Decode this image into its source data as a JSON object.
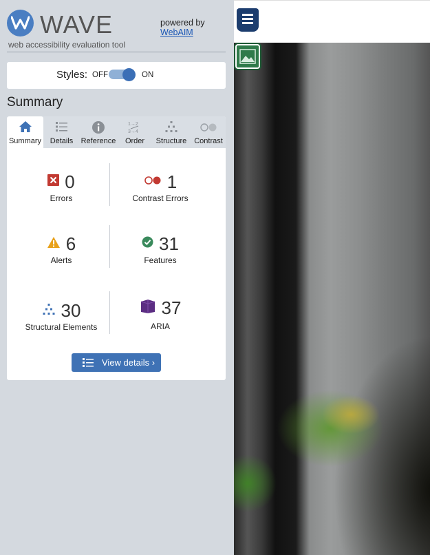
{
  "app": {
    "logo_text": "WAVE",
    "tagline": "web accessibility evaluation tool",
    "powered_by": "powered by",
    "powered_link": "WebAIM"
  },
  "styles": {
    "label": "Styles:",
    "off": "OFF",
    "on": "ON",
    "enabled": true
  },
  "section_title": "Summary",
  "tabs": [
    {
      "label": "Summary",
      "icon": "home-icon",
      "active": true
    },
    {
      "label": "Details",
      "icon": "list-icon",
      "active": false
    },
    {
      "label": "Reference",
      "icon": "info-icon",
      "active": false
    },
    {
      "label": "Order",
      "icon": "order-icon",
      "active": false
    },
    {
      "label": "Structure",
      "icon": "structure-icon",
      "active": false
    },
    {
      "label": "Contrast",
      "icon": "contrast-icon",
      "active": false
    }
  ],
  "summary": {
    "errors": {
      "count": "0",
      "label": "Errors",
      "icon": "error-icon",
      "color": "#c0392b"
    },
    "contrast_errors": {
      "count": "1",
      "label": "Contrast Errors",
      "icon": "contrast-error-icon",
      "color": "#c0392b"
    },
    "alerts": {
      "count": "6",
      "label": "Alerts",
      "icon": "alert-icon",
      "color": "#e8a11a"
    },
    "features": {
      "count": "31",
      "label": "Features",
      "icon": "feature-icon",
      "color": "#3a8a5c"
    },
    "structural": {
      "count": "30",
      "label": "Structural Elements",
      "icon": "structure-icon",
      "color": "#3f72b5"
    },
    "aria": {
      "count": "37",
      "label": "ARIA",
      "icon": "aria-icon",
      "color": "#5b2d82"
    }
  },
  "view_details": "View details ›",
  "colors": {
    "sidebar_bg": "#d4d9df",
    "accent": "#3f72b5",
    "tab_bar_bg": "#d9dee4"
  }
}
